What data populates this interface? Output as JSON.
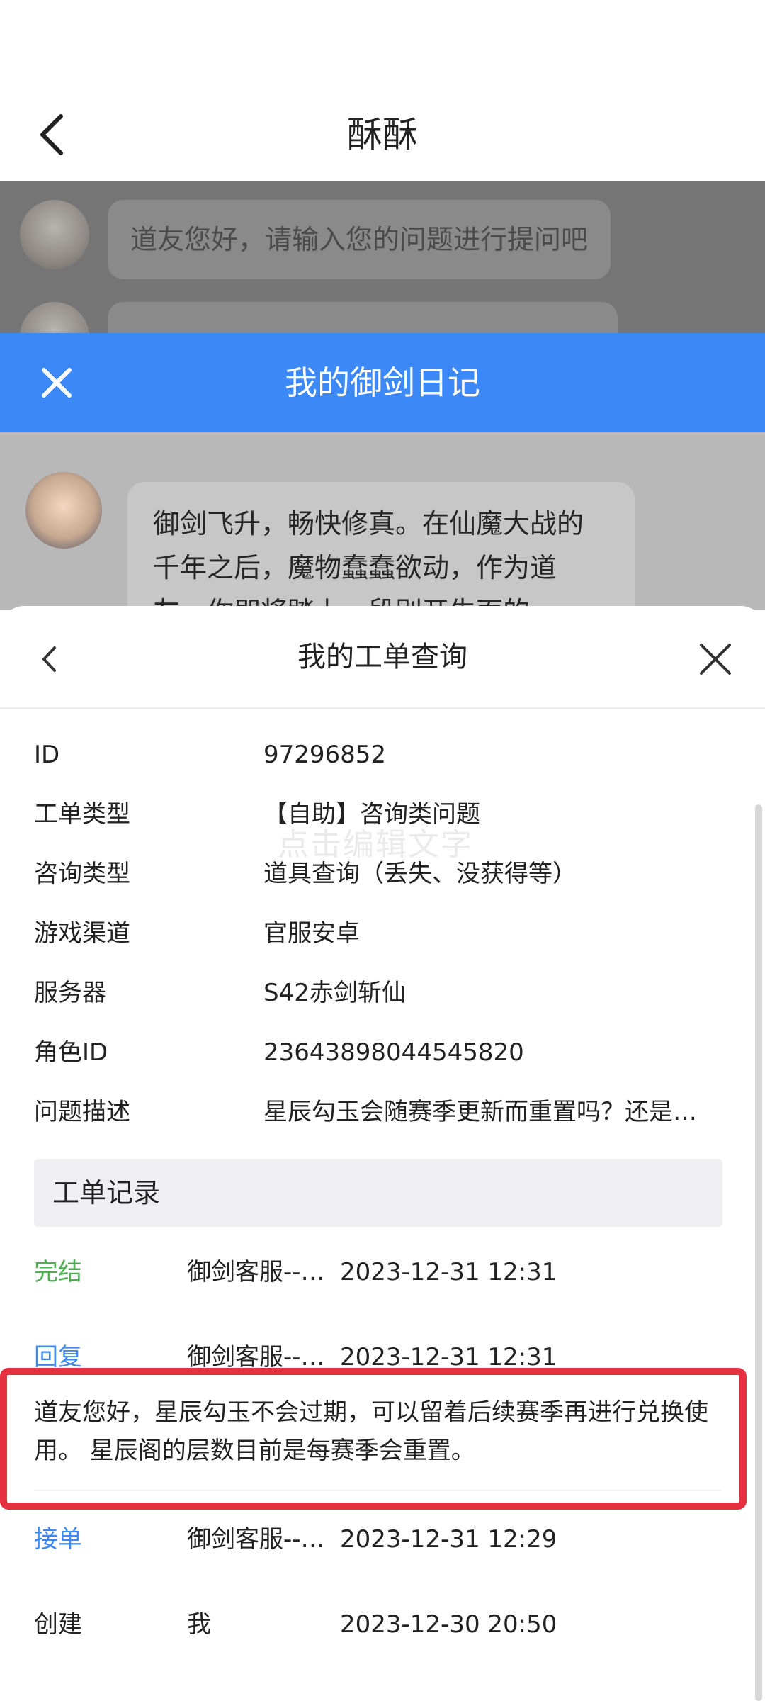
{
  "header": {
    "title": "酥酥",
    "back_icon": "chevron-left-icon"
  },
  "chat": {
    "messages": [
      {
        "text": "道友您好，请输入您的问题进行提问吧"
      },
      {
        "text": ""
      }
    ]
  },
  "diary_bar": {
    "title": "我的御剑日记",
    "close_icon": "close-icon",
    "color": "#3d88f7"
  },
  "intro": {
    "text": "御剑飞升，畅快修真。在仙魔大战的千年之后，魔物蠢蠢欲动，作为道友，你即将踏上一段别开生面的"
  },
  "sheet": {
    "title": "我的工单查询",
    "back_icon": "chevron-left-icon",
    "close_icon": "close-icon",
    "watermark": "点击编辑文字",
    "fields": [
      {
        "label": "ID",
        "value": "97296852"
      },
      {
        "label": "工单类型",
        "value": "【自助】咨询类问题"
      },
      {
        "label": "咨询类型",
        "value": "道具查询（丢失、没获得等）"
      },
      {
        "label": "游戏渠道",
        "value": "官服安卓"
      },
      {
        "label": "服务器",
        "value": "S42赤剑斩仙"
      },
      {
        "label": "角色ID",
        "value": "23643898044545820"
      },
      {
        "label": "问题描述",
        "value": "星辰勾玉会随赛季更新而重置吗？还是…"
      }
    ],
    "records_title": "工单记录",
    "records": [
      {
        "status": "完结",
        "actor": "御剑客服--…",
        "time": "2023-12-31 12:31",
        "color": "#4caf50"
      },
      {
        "status": "回复",
        "actor": "御剑客服--…",
        "time": "2023-12-31 12:31",
        "color": "#3d88f7"
      },
      {
        "status": "接单",
        "actor": "御剑客服--…",
        "time": "2023-12-31 12:29",
        "color": "#3d88f7"
      },
      {
        "status": "创建",
        "actor": "我",
        "time": "2023-12-30 20:50",
        "color": "#222222"
      }
    ],
    "reply_text": "道友您好，星辰勾玉不会过期，可以留着后续赛季再进行兑换使用。 星辰阁的层数目前是每赛季会重置。",
    "highlight_color": "#e5313f"
  }
}
